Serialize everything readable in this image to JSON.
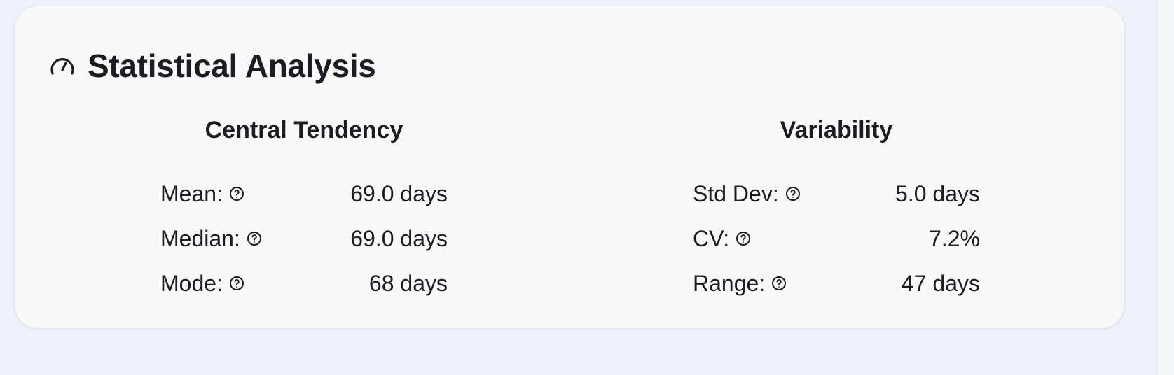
{
  "card": {
    "title": "Statistical Analysis",
    "icon": "gauge-icon"
  },
  "central_tendency": {
    "title": "Central Tendency",
    "rows": [
      {
        "label": "Mean:",
        "value": "69.0 days",
        "help_icon": "help-circle-icon"
      },
      {
        "label": "Median:",
        "value": "69.0 days",
        "help_icon": "help-circle-icon"
      },
      {
        "label": "Mode:",
        "value": "68 days",
        "help_icon": "help-circle-icon"
      }
    ]
  },
  "variability": {
    "title": "Variability",
    "rows": [
      {
        "label": "Std Dev:",
        "value": "5.0 days",
        "help_icon": "help-circle-icon"
      },
      {
        "label": "CV:",
        "value": "7.2%",
        "help_icon": "help-circle-icon"
      },
      {
        "label": "Range:",
        "value": "47 days",
        "help_icon": "help-circle-icon"
      }
    ]
  },
  "colors": {
    "page_background": "#eff2fb",
    "card_background": "#f7f8f7",
    "text": "#1b1d22"
  }
}
